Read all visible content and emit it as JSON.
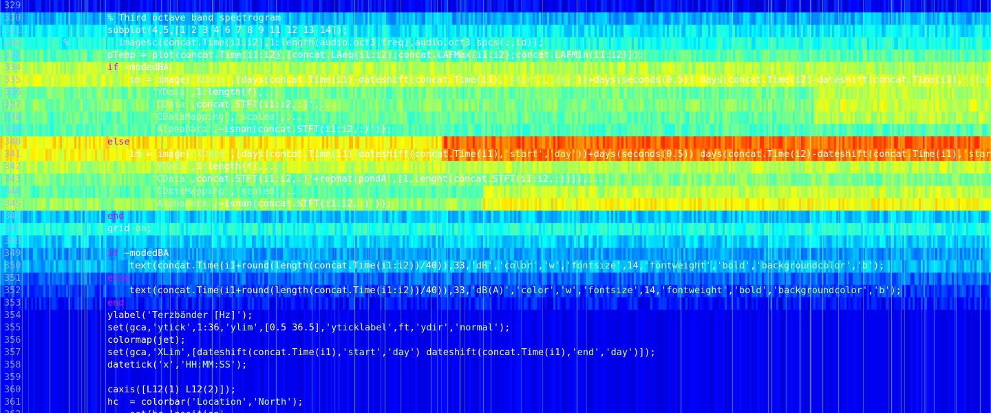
{
  "editor": {
    "lines": [
      {
        "no": "329",
        "marker": "",
        "indent": 0,
        "tokens": []
      },
      {
        "no": "330",
        "marker": "",
        "indent": 0,
        "tokens": [
          {
            "t": "cmt",
            "v": "% Third octave band spectrogram"
          }
        ]
      },
      {
        "no": "331",
        "marker": "",
        "indent": 0,
        "tokens": [
          {
            "t": "plain",
            "v": "subplot(4,5,[1 2 3 4 6 7 8 9 11 12 13 14]);"
          }
        ]
      },
      {
        "no": "332",
        "marker": "%",
        "indent": 2,
        "tokens": [
          {
            "t": "cm",
            "v": "imagesc(concat.Time(i1:i2),1:length(audio.oct3.freq),audio.oct3.spcs(:,id));"
          }
        ]
      },
      {
        "no": "333",
        "marker": "",
        "indent": 0,
        "tokens": [
          {
            "t": "plain",
            "v": "pTemp = plot(concat.Time(i1:i2),[concat.LAeq(i1:i2);concat.LAFMax(i1:i2);concat.LAFMin(i1:i2)]);"
          }
        ]
      },
      {
        "no": "334",
        "marker": "",
        "indent": 0,
        "tokens": [
          {
            "t": "kw",
            "v": "if"
          },
          {
            "t": "plain",
            "v": " ~modedBA"
          }
        ]
      },
      {
        "no": "335",
        "marker": "",
        "indent": 4,
        "tokens": [
          {
            "t": "plain",
            "v": "im = image("
          },
          {
            "t": "str",
            "v": "'XData'"
          },
          {
            "t": "plain",
            "v": ",[days(concat.Time(i1)-dateshift(concat.Time(i1),"
          },
          {
            "t": "str",
            "v": "'start'"
          },
          {
            "t": "plain",
            "v": ","
          },
          {
            "t": "str",
            "v": "'day'"
          },
          {
            "t": "plain",
            "v": "))+days(seconds(0.5)) days(concat.Time(i2)-dateshift(concat.Time(i1),"
          },
          {
            "t": "str",
            "v": "'start'"
          }
        ]
      },
      {
        "no": "336",
        "marker": "",
        "indent": 8,
        "tokens": [
          {
            "t": "str",
            "v": "'YData'"
          },
          {
            "t": "plain",
            "v": ",1:length(f),..."
          }
        ]
      },
      {
        "no": "337",
        "marker": "",
        "indent": 8,
        "tokens": [
          {
            "t": "str",
            "v": "'CData'"
          },
          {
            "t": "plain",
            "v": ",concat.STFT(i1:i2,:)',..."
          }
        ]
      },
      {
        "no": "338",
        "marker": "",
        "indent": 8,
        "tokens": [
          {
            "t": "str",
            "v": "'CDataMapping'"
          },
          {
            "t": "plain",
            "v": ","
          },
          {
            "t": "str",
            "v": "'scaled'"
          },
          {
            "t": "plain",
            "v": ",..."
          }
        ]
      },
      {
        "no": "339",
        "marker": "",
        "indent": 8,
        "tokens": [
          {
            "t": "str",
            "v": "'AlphaData'"
          },
          {
            "t": "plain",
            "v": ",~isnan(concat.STFT(i1:i2,:)'));"
          }
        ]
      },
      {
        "no": "340",
        "marker": "",
        "indent": 0,
        "tokens": [
          {
            "t": "kw",
            "v": "else"
          }
        ]
      },
      {
        "no": "341",
        "marker": "",
        "indent": 4,
        "tokens": [
          {
            "t": "plain",
            "v": "im = image("
          },
          {
            "t": "str",
            "v": "'XData'"
          },
          {
            "t": "plain",
            "v": ",[days(concat.Time(i1)-dateshift(concat.Time(i1),"
          },
          {
            "t": "str",
            "v": "'start'"
          },
          {
            "t": "plain",
            "v": ","
          },
          {
            "t": "str",
            "v": "'day'"
          },
          {
            "t": "plain",
            "v": "))+days(seconds(0.5)) days(concat.Time(i2)-dateshift(concat.Time(i1),"
          },
          {
            "t": "str",
            "v": "'start'"
          }
        ]
      },
      {
        "no": "342",
        "marker": "",
        "indent": 8,
        "tokens": [
          {
            "t": "str",
            "v": "'YData'"
          },
          {
            "t": "plain",
            "v": ",1:length(f),..."
          }
        ]
      },
      {
        "no": "343",
        "marker": "",
        "indent": 8,
        "tokens": [
          {
            "t": "str",
            "v": "'CData'"
          },
          {
            "t": "plain",
            "v": ",concat.STFT(i1:i2,:)'+repmat(pondA',[1,lenght(concat.STFT(i1:i2,:))]),..."
          }
        ]
      },
      {
        "no": "344",
        "marker": "",
        "indent": 8,
        "tokens": [
          {
            "t": "str",
            "v": "'CDataMapping'"
          },
          {
            "t": "plain",
            "v": ","
          },
          {
            "t": "str",
            "v": "'scaled'"
          },
          {
            "t": "plain",
            "v": ",..."
          }
        ]
      },
      {
        "no": "345",
        "marker": "",
        "indent": 8,
        "tokens": [
          {
            "t": "str",
            "v": "'AlphaData'"
          },
          {
            "t": "plain",
            "v": ",~isnan(concat.STFT(i1:i2,:)'));"
          }
        ]
      },
      {
        "no": "346",
        "marker": "",
        "indent": 0,
        "tokens": [
          {
            "t": "kw",
            "v": "end"
          }
        ]
      },
      {
        "no": "347",
        "marker": "",
        "indent": 0,
        "tokens": [
          {
            "t": "plain",
            "v": "grid "
          },
          {
            "t": "str",
            "v": "on"
          },
          {
            "t": "plain",
            "v": ";"
          }
        ]
      },
      {
        "no": "348",
        "marker": "",
        "indent": 0,
        "tokens": []
      },
      {
        "no": "349",
        "marker": "",
        "indent": 0,
        "tokens": [
          {
            "t": "kw",
            "v": "if"
          },
          {
            "t": "plain",
            "v": " ~modedBA"
          }
        ]
      },
      {
        "no": "350",
        "marker": "",
        "indent": 4,
        "tokens": [
          {
            "t": "plain",
            "v": "text(concat.Time(i1+round(length(concat.Time(i1:i2))/40)),33,"
          },
          {
            "t": "str",
            "v": "'dB'"
          },
          {
            "t": "plain",
            "v": ","
          },
          {
            "t": "str",
            "v": "'color'"
          },
          {
            "t": "plain",
            "v": ","
          },
          {
            "t": "str",
            "v": "'w'"
          },
          {
            "t": "plain",
            "v": ","
          },
          {
            "t": "str",
            "v": "'fontsize'"
          },
          {
            "t": "plain",
            "v": ",14,"
          },
          {
            "t": "str",
            "v": "'fontweight'"
          },
          {
            "t": "plain",
            "v": ","
          },
          {
            "t": "str",
            "v": "'bold'"
          },
          {
            "t": "plain",
            "v": ","
          },
          {
            "t": "str",
            "v": "'backgroundcolor'"
          },
          {
            "t": "plain",
            "v": ","
          },
          {
            "t": "str",
            "v": "'b'"
          },
          {
            "t": "plain",
            "v": ");"
          }
        ]
      },
      {
        "no": "351",
        "marker": "",
        "indent": 0,
        "tokens": [
          {
            "t": "kw",
            "v": "else"
          }
        ]
      },
      {
        "no": "352",
        "marker": "",
        "indent": 4,
        "tokens": [
          {
            "t": "plain",
            "v": "text(concat.Time(i1+round(length(concat.Time(i1:i2))/40)),33,"
          },
          {
            "t": "str",
            "v": "'dB(A)'"
          },
          {
            "t": "plain",
            "v": ","
          },
          {
            "t": "str",
            "v": "'color'"
          },
          {
            "t": "plain",
            "v": ","
          },
          {
            "t": "str",
            "v": "'w'"
          },
          {
            "t": "plain",
            "v": ","
          },
          {
            "t": "str",
            "v": "'fontsize'"
          },
          {
            "t": "plain",
            "v": ",14,"
          },
          {
            "t": "str",
            "v": "'fontweight'"
          },
          {
            "t": "plain",
            "v": ","
          },
          {
            "t": "str",
            "v": "'bold'"
          },
          {
            "t": "plain",
            "v": ","
          },
          {
            "t": "str",
            "v": "'backgroundcolor'"
          },
          {
            "t": "plain",
            "v": ","
          },
          {
            "t": "str",
            "v": "'b'"
          },
          {
            "t": "plain",
            "v": ");"
          }
        ]
      },
      {
        "no": "353",
        "marker": "",
        "indent": 0,
        "tokens": [
          {
            "t": "kw",
            "v": "end"
          }
        ]
      },
      {
        "no": "354",
        "marker": "",
        "indent": 0,
        "tokens": [
          {
            "t": "plain",
            "v": "ylabel("
          },
          {
            "t": "str",
            "v": "'Terzbänder [Hz]'"
          },
          {
            "t": "plain",
            "v": ");"
          }
        ]
      },
      {
        "no": "355",
        "marker": "",
        "indent": 0,
        "tokens": [
          {
            "t": "plain",
            "v": "set(gca,"
          },
          {
            "t": "str",
            "v": "'ytick'"
          },
          {
            "t": "plain",
            "v": ",1:36,"
          },
          {
            "t": "str",
            "v": "'ylim'"
          },
          {
            "t": "plain",
            "v": ",[0.5 36.5],"
          },
          {
            "t": "str",
            "v": "'yticklabel'"
          },
          {
            "t": "plain",
            "v": ",ft,"
          },
          {
            "t": "str",
            "v": "'ydir'"
          },
          {
            "t": "plain",
            "v": ","
          },
          {
            "t": "str",
            "v": "'normal'"
          },
          {
            "t": "plain",
            "v": ");"
          }
        ]
      },
      {
        "no": "356",
        "marker": "",
        "indent": 0,
        "tokens": [
          {
            "t": "plain",
            "v": "colormap(jet);"
          }
        ]
      },
      {
        "no": "357",
        "marker": "",
        "indent": 0,
        "tokens": [
          {
            "t": "plain",
            "v": "set(gca,"
          },
          {
            "t": "str",
            "v": "'XLim'"
          },
          {
            "t": "plain",
            "v": ",[dateshift(concat.Time(i1),"
          },
          {
            "t": "str",
            "v": "'start'"
          },
          {
            "t": "plain",
            "v": ","
          },
          {
            "t": "str",
            "v": "'day'"
          },
          {
            "t": "plain",
            "v": ") dateshift(concat.Time(i1),"
          },
          {
            "t": "str",
            "v": "'end'"
          },
          {
            "t": "plain",
            "v": ","
          },
          {
            "t": "str",
            "v": "'day'"
          },
          {
            "t": "plain",
            "v": ")]);"
          }
        ]
      },
      {
        "no": "358",
        "marker": "",
        "indent": 0,
        "tokens": [
          {
            "t": "plain",
            "v": "datetick("
          },
          {
            "t": "str",
            "v": "'x'"
          },
          {
            "t": "plain",
            "v": ","
          },
          {
            "t": "str",
            "v": "'HH:MM:SS'"
          },
          {
            "t": "plain",
            "v": ");"
          }
        ]
      },
      {
        "no": "359",
        "marker": "",
        "indent": 0,
        "tokens": []
      },
      {
        "no": "360",
        "marker": "",
        "indent": 0,
        "tokens": [
          {
            "t": "plain",
            "v": "caxis([L12(1) L12(2)]);"
          }
        ]
      },
      {
        "no": "361",
        "marker": "",
        "indent": 0,
        "tokens": [
          {
            "t": "plain",
            "v": "hc  = colorbar("
          },
          {
            "t": "str",
            "v": "'Location'"
          },
          {
            "t": "plain",
            "v": ","
          },
          {
            "t": "str",
            "v": "'North'"
          },
          {
            "t": "plain",
            "v": ");"
          }
        ]
      },
      {
        "no": "362",
        "marker": "",
        "indent": 0,
        "tokens": [
          {
            "t": "plain",
            "v": "    set(hc,'position',..."
          }
        ]
      }
    ]
  },
  "colors": {
    "keyword": "#e600e6",
    "string": "#c8ffb0",
    "comment": "#d8ffd8",
    "code": "#ffffff",
    "line_number": "#9db5ff"
  }
}
